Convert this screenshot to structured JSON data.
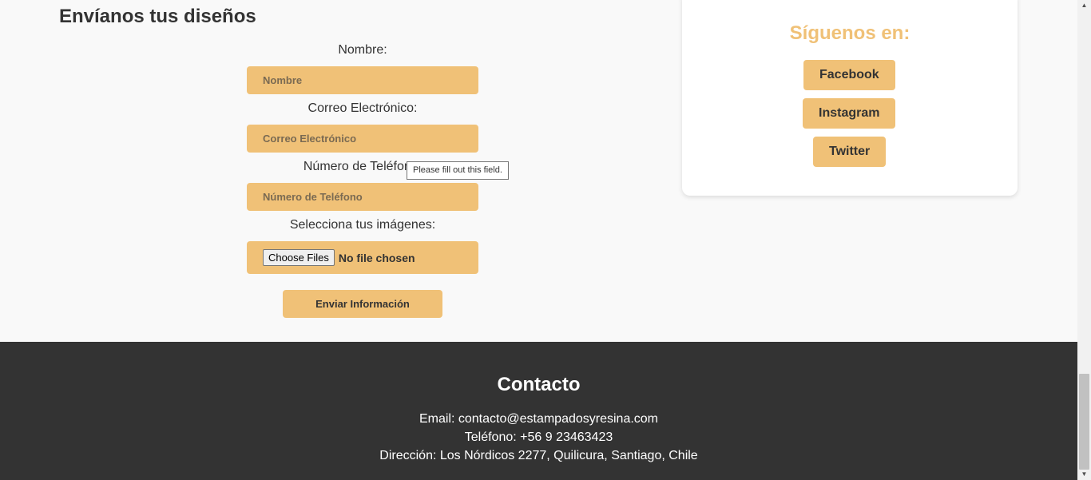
{
  "form": {
    "title": "Envíanos tus diseños",
    "name_label": "Nombre:",
    "name_placeholder": "Nombre",
    "email_label": "Correo Electrónico:",
    "email_placeholder": "Correo Electrónico",
    "phone_label": "Número de Teléfono:",
    "phone_placeholder": "Número de Teléfono",
    "images_label": "Selecciona tus imágenes:",
    "file_button_label": "Choose Files",
    "file_status": "No file chosen",
    "submit_label": "Enviar Información",
    "validation_tooltip": "Please fill out this field."
  },
  "social": {
    "title": "Síguenos en:",
    "links": [
      "Facebook",
      "Instagram",
      "Twitter"
    ]
  },
  "footer": {
    "title": "Contacto",
    "email": "Email: contacto@estampadosyresina.com",
    "phone": "Teléfono: +56 9 23463423",
    "address": "Dirección: Los Nórdicos 2277, Quilicura, Santiago, Chile"
  },
  "colors": {
    "accent": "#f0c177",
    "footer_bg": "#333333",
    "page_bg": "#f9f9f9"
  }
}
